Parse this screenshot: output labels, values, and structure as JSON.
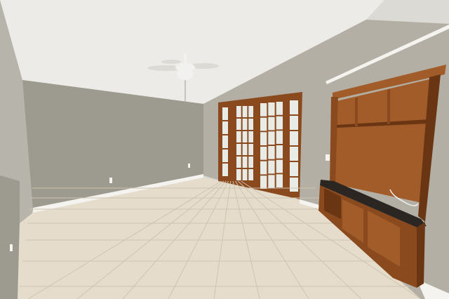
{
  "scene": {
    "kind": "photo",
    "subject": "empty-living-room",
    "objects": [
      "vaulted-ceiling",
      "ceiling-fan",
      "french-doors",
      "built-in-entertainment-center",
      "tile-floor",
      "baseboard",
      "wall-outlet",
      "light-switch"
    ]
  },
  "colors": {
    "ceiling": "#ecebe7",
    "ceiling_shadow": "#dcdad4",
    "wall_left": "#a19e93",
    "wall_back": "#9d9a8f",
    "wall_right": "#b3afa4",
    "wall_near_left": "#b7b4ab",
    "floor": "#e6dccb",
    "floor_grout": "#cfc4b0",
    "baseboard": "#f4f3ef",
    "wood": "#8a4a1e",
    "wood_dark": "#6a3512",
    "wood_light": "#a25c2a",
    "countertop": "#2b2622",
    "glass": "#e9ece6",
    "fan_white": "#f1f1ef"
  }
}
